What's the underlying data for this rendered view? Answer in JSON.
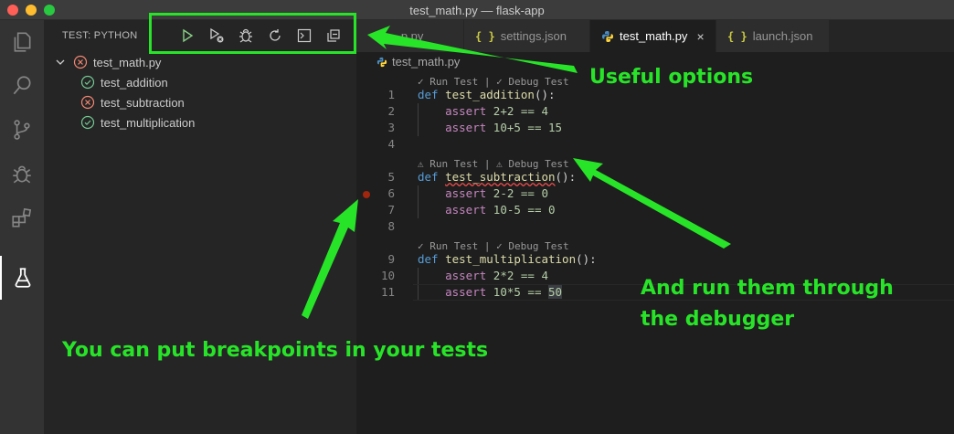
{
  "window": {
    "title": "test_math.py — flask-app"
  },
  "activity_bar": [
    "explorer-icon",
    "search-icon",
    "source-control-icon",
    "debug-icon",
    "extensions-icon",
    "testing-icon"
  ],
  "sidebar": {
    "title": "TEST: PYTHON",
    "toolbar": [
      "run-all-tests",
      "debug-all-tests",
      "debug-icon",
      "refresh-icon",
      "terminal-icon",
      "collapse-all"
    ],
    "tree": {
      "root": {
        "label": "test_math.py",
        "status": "failed"
      },
      "children": [
        {
          "label": "test_addition",
          "status": "passed"
        },
        {
          "label": "test_subtraction",
          "status": "failed"
        },
        {
          "label": "test_multiplication",
          "status": "passed"
        }
      ]
    }
  },
  "tabs": [
    {
      "label": "...p.py",
      "kind": "python"
    },
    {
      "label": "settings.json",
      "kind": "json"
    },
    {
      "label": "test_math.py",
      "kind": "python",
      "active": true
    },
    {
      "label": "launch.json",
      "kind": "json"
    }
  ],
  "breadcrumb": "test_math.py",
  "editor": {
    "lenses": {
      "one": "✓ Run Test | ✓ Debug Test",
      "two": "⚠ Run Test | ⚠ Debug Test",
      "three": "✓ Run Test | ✓ Debug Test"
    },
    "line_numbers": [
      "1",
      "2",
      "3",
      "4",
      "5",
      "6",
      "7",
      "8",
      "9",
      "10",
      "11"
    ],
    "lines": {
      "l1": {
        "kw": "def",
        "name": "test_addition",
        "rest": "():"
      },
      "l2": {
        "kw": "assert",
        "expr": "2+2 == 4"
      },
      "l3": {
        "kw": "assert",
        "expr": "10+5 == 15"
      },
      "l5": {
        "kw": "def",
        "name": "test_subtraction",
        "rest": "():"
      },
      "l6": {
        "kw": "assert",
        "expr": "2-2 == 0"
      },
      "l7": {
        "kw": "assert",
        "expr": "10-5 == 0"
      },
      "l9": {
        "kw": "def",
        "name": "test_multiplication",
        "rest": "():"
      },
      "l10": {
        "kw": "assert",
        "expr": "2*2 == 4"
      },
      "l11": {
        "kw": "assert",
        "expr_before": "10*5 == ",
        "expr_hl": "50"
      }
    }
  },
  "annotations": {
    "useful": "Useful options",
    "debugger_line1": "And run them through",
    "debugger_line2": "the debugger",
    "breakpoints": "You can put breakpoints in your tests"
  },
  "colors": {
    "annotation": "#28e428",
    "passed": "#73c991",
    "failed": "#f48771",
    "breakpoint": "#a1260d"
  }
}
